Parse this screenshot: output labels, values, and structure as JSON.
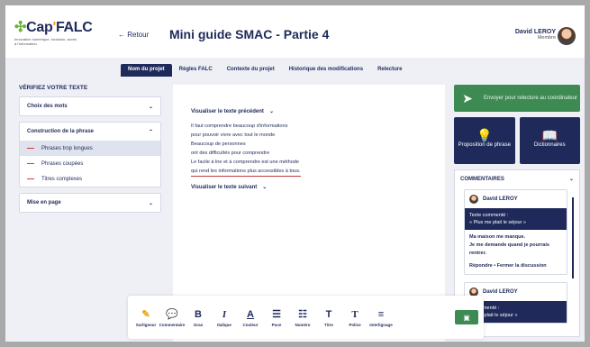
{
  "header": {
    "logo": {
      "part1": "Cap",
      "part2": "'",
      "part3": "FALC",
      "tagline": "Innovation numérique, inclusion, accès à l'information"
    },
    "back_label": "← Retour",
    "title": "Mini guide SMAC - Partie 4",
    "user": {
      "name": "David LEROY",
      "role": "Membre"
    }
  },
  "tabs": [
    {
      "label": "Nom du projet",
      "active": true
    },
    {
      "label": "Règles FALC",
      "active": false
    },
    {
      "label": "Contexte du projet",
      "active": false
    },
    {
      "label": "Historique des modifications",
      "active": false
    },
    {
      "label": "Relecture",
      "active": false
    }
  ],
  "sidebar": {
    "title": "VÉRIFIEZ VOTRE TEXTE",
    "sections": [
      {
        "label": "Choix des mots",
        "chevron": "⌄"
      },
      {
        "label": "Construction de la phrase",
        "chevron": "⌃",
        "items": [
          "Phrases trop longues",
          "Phrases coupées",
          "Titres complexes"
        ]
      },
      {
        "label": "Mise en page",
        "chevron": "⌄"
      }
    ]
  },
  "editor": {
    "prev_label": "Visualiser le texte précédent",
    "next_label": "Visualiser le texte suivant",
    "lines": [
      "Il faut comprendre beaucoup d'informations",
      "pour pouvoir vivre avec tout le monde",
      "Beaucoup de personnes",
      "ont des difficultés pour comprendre",
      "Le facile à lire et à comprendre est une méthode",
      "qui rend les informations plus accessibles à tous."
    ]
  },
  "right_panel": {
    "send_label": "Envoyer pour relecture au coordinateur",
    "tiles": [
      {
        "label": "Proposition de phrase",
        "icon": "lightbulb-icon"
      },
      {
        "label": "Dictionnaires",
        "icon": "book-icon"
      }
    ],
    "comments": {
      "title": "COMMENTAIRES",
      "items": [
        {
          "user": "David LEROY",
          "quote_label": "Texte commenté :",
          "quote": "« Plus me plait le séjour »",
          "body": "Ma maison me manque.\nJe me demande quand je pourrais rentrer.",
          "actions": "Répondre • Fermer la discussion"
        },
        {
          "user": "David LEROY",
          "quote_label": "e commenté :",
          "quote": "us me plait le séjour »",
          "body": "",
          "actions": ""
        }
      ]
    }
  },
  "toolbar": {
    "tools": [
      {
        "glyph": "✎",
        "label": "Surligneur"
      },
      {
        "glyph": "💬",
        "label": "Commentaire"
      },
      {
        "glyph": "B",
        "label": "Gras"
      },
      {
        "glyph": "I",
        "label": "Italique"
      },
      {
        "glyph": "A",
        "label": "Couleur"
      },
      {
        "glyph": "☰",
        "label": "Puce"
      },
      {
        "glyph": "☷",
        "label": "Numéro"
      },
      {
        "glyph": "T",
        "label": "Titre"
      },
      {
        "glyph": "T",
        "label": "Police"
      },
      {
        "glyph": "≡",
        "label": "Interlignage"
      }
    ],
    "save_icon": "save-icon"
  },
  "colors": {
    "navy": "#1f2a5a",
    "green": "#3d8b52",
    "red": "#c0392b",
    "accent_orange": "#f0a020",
    "logo_green": "#6bb33a"
  }
}
